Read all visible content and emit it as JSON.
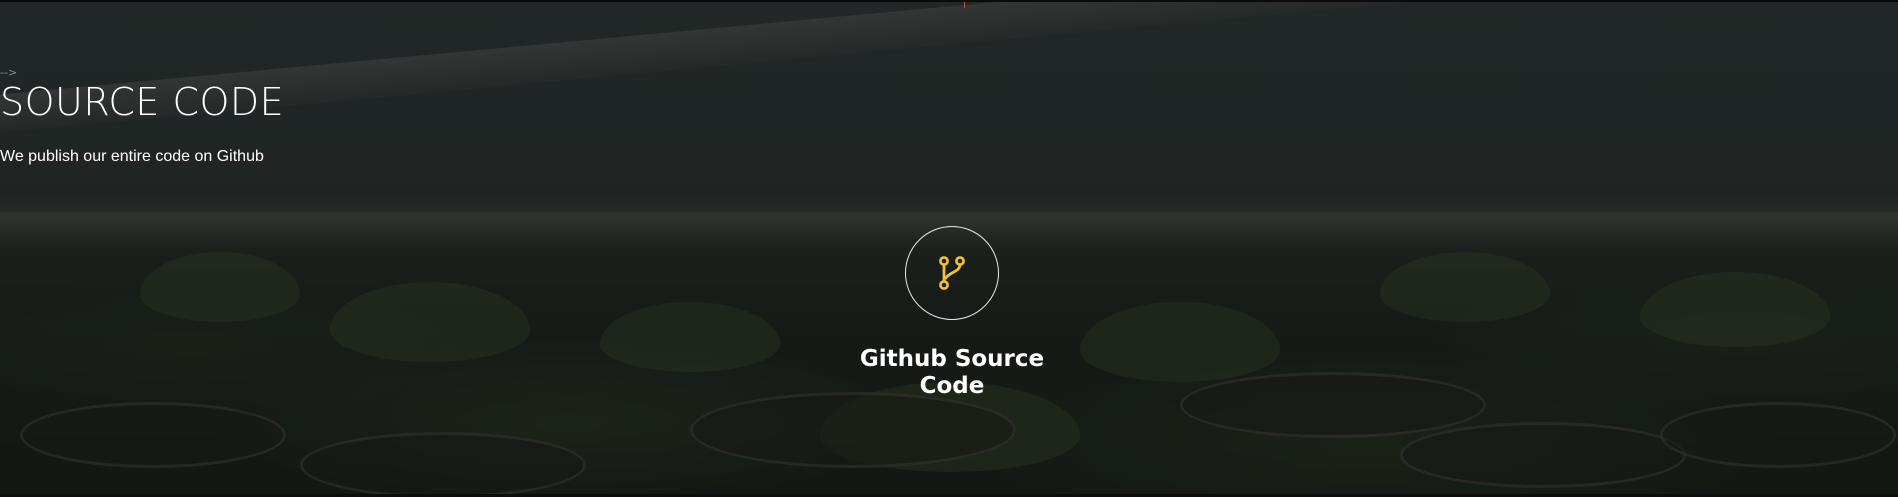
{
  "section": {
    "title": "SOURCE CODE",
    "subtitle": "We publish our entire code on Github",
    "comment_residue": "-->"
  },
  "card": {
    "icon": "code-branch-icon",
    "title": "Github Source Code"
  },
  "colors": {
    "accent": "#f1c232",
    "text": "#ffffff",
    "overlay": "#1f2423"
  }
}
